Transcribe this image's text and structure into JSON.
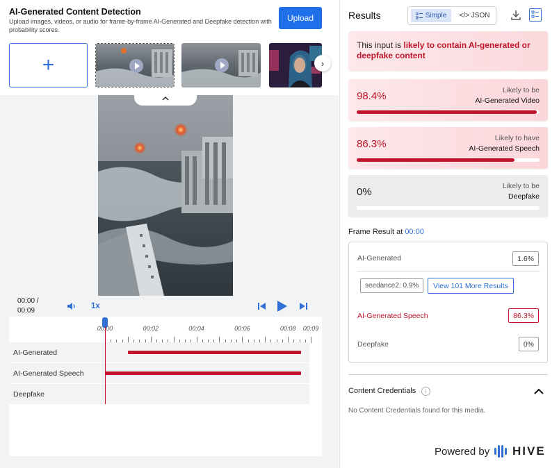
{
  "app": {
    "title": "AI-Generated Content Detection",
    "description": "Upload images, videos, or audio for frame-by-frame AI-Generated and Deepfake detection with probability scores.",
    "upload_label": "Upload"
  },
  "gallery": {
    "add_symbol": "+",
    "thumbnails": [
      {
        "kind": "video",
        "selected": true
      },
      {
        "kind": "video",
        "selected": false
      },
      {
        "kind": "image",
        "selected": false
      }
    ],
    "next_icon": "chevron-right-icon"
  },
  "player": {
    "current_time": "00:00 /",
    "duration": "00:09",
    "speed": "1x",
    "ticks": [
      "00:00",
      "00:02",
      "00:04",
      "00:06",
      "00:08",
      "00:09"
    ],
    "playhead_time": "00:00",
    "tracks": [
      {
        "label": "AI-Generated",
        "segments": [
          [
            1,
            9
          ]
        ]
      },
      {
        "label": "AI-Generated Speech",
        "segments": [
          [
            0,
            9
          ]
        ]
      },
      {
        "label": "Deepfake",
        "segments": []
      }
    ]
  },
  "results": {
    "title": "Results",
    "view_simple": "Simple",
    "view_json": "</> JSON",
    "verdict_prefix": "This input is ",
    "verdict_bold": "likely to contain AI-generated or deepfake content",
    "scores": [
      {
        "pct": "98.4%",
        "value": 0.984,
        "line1": "Likely to be",
        "line2": "AI-Generated Video",
        "style": "red"
      },
      {
        "pct": "86.3%",
        "value": 0.863,
        "line1": "Likely to have",
        "line2": "AI-Generated Speech",
        "style": "red"
      },
      {
        "pct": "0%",
        "value": 0.0,
        "line1": "Likely to be",
        "line2": "Deepfake",
        "style": "grey"
      }
    ],
    "frame_result_label": "Frame Result at ",
    "frame_time": "00:00",
    "frame": {
      "ai_generated_label": "AI-Generated",
      "ai_generated_value": "1.6%",
      "model_chip": "seedance2: 0.9%",
      "more_results": "View 101 More Results",
      "speech_label": "AI-Generated Speech",
      "speech_value": "86.3%",
      "deepfake_label": "Deepfake",
      "deepfake_value": "0%"
    },
    "credentials_title": "Content Credentials",
    "credentials_info": "i",
    "credentials_text": "No Content Credentials found for this media.",
    "powered_by": "Powered by",
    "brand": "HIVE"
  },
  "colors": {
    "accent": "#1f6feb",
    "alert_red": "#c0152a"
  }
}
